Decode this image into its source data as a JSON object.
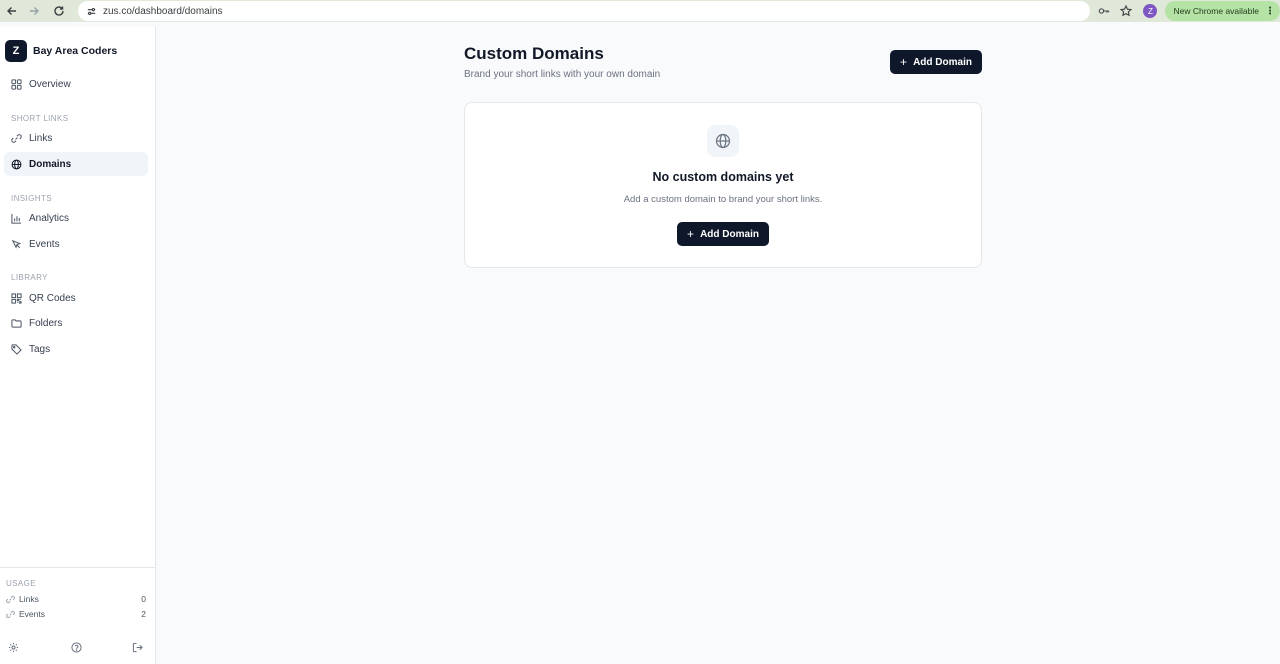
{
  "browser": {
    "url": "zus.co/dashboard/domains",
    "profile_initial": "Z",
    "update_label": "New Chrome available"
  },
  "sidebar": {
    "brand_initial": "Z",
    "brand_name": "Bay Area Coders",
    "overview_label": "Overview",
    "sections": {
      "short_links": "SHORT LINKS",
      "insights": "INSIGHTS",
      "library": "LIBRARY",
      "usage": "USAGE"
    },
    "items": {
      "links": "Links",
      "domains": "Domains",
      "analytics": "Analytics",
      "events": "Events",
      "qr_codes": "QR Codes",
      "folders": "Folders",
      "tags": "Tags"
    },
    "usage": [
      {
        "label": "Links",
        "count": "0"
      },
      {
        "label": "Events",
        "count": "2"
      }
    ]
  },
  "main": {
    "title": "Custom Domains",
    "subtitle": "Brand your short links with your own domain",
    "add_button": "Add Domain",
    "empty_state": {
      "title": "No custom domains yet",
      "text": "Add a custom domain to brand your short links.",
      "button": "Add Domain"
    }
  },
  "icons": {
    "back": "arrow-left-icon",
    "forward": "arrow-right-icon",
    "reload": "reload-icon",
    "globe": "globe-icon",
    "link": "link-icon"
  },
  "colors": {
    "primary_button": "#0f172a",
    "active_nav": "#f1f5f9",
    "chrome_bar": "#dfe8d9",
    "update_pill": "#b5e3a6"
  }
}
